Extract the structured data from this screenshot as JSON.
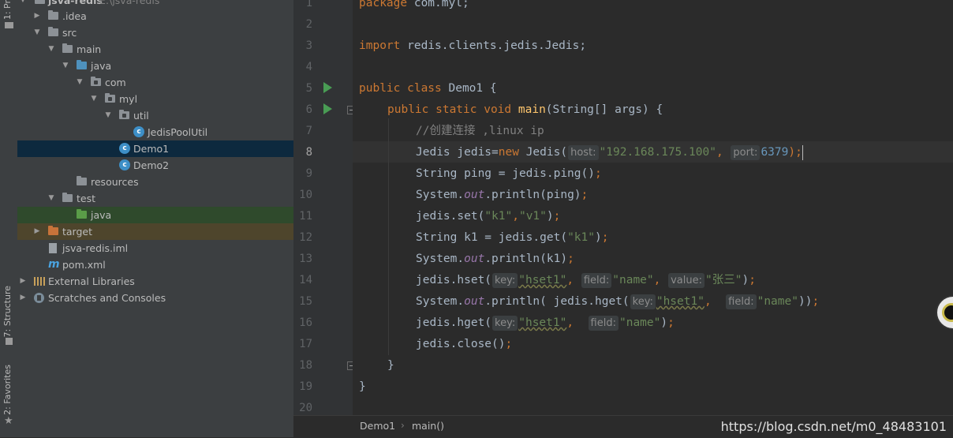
{
  "stripe": {
    "project_tab": "1: Pr",
    "structure_tab": "7: Structure",
    "favorites_tab": "2: Favorites"
  },
  "tree": [
    {
      "label": "jsva-redis",
      "hint": "E:\\jsva-redis"
    },
    {
      "label": ".idea"
    },
    {
      "label": "src"
    },
    {
      "label": "main"
    },
    {
      "label": "java"
    },
    {
      "label": "com"
    },
    {
      "label": "myl"
    },
    {
      "label": "util"
    },
    {
      "label": "JedisPoolUtil"
    },
    {
      "label": "Demo1"
    },
    {
      "label": "Demo2"
    },
    {
      "label": "resources"
    },
    {
      "label": "test"
    },
    {
      "label": "java"
    },
    {
      "label": "target"
    },
    {
      "label": "jsva-redis.iml"
    },
    {
      "label": "pom.xml"
    },
    {
      "label": "External Libraries"
    },
    {
      "label": "Scratches and Consoles"
    }
  ],
  "line_numbers": [
    "1",
    "2",
    "3",
    "4",
    "5",
    "6",
    "7",
    "8",
    "9",
    "10",
    "11",
    "12",
    "13",
    "14",
    "15",
    "16",
    "17",
    "18",
    "19",
    "20"
  ],
  "code": {
    "l1_kw": "package",
    "l1_rest": " com.myl;",
    "l3_kw": "import",
    "l3_rest": " redis.clients.jedis.Jedis;",
    "l5_kw": "public class",
    "l5_rest": " Demo1 {",
    "l6_kw": "public static void",
    "l6_fn": "main",
    "l6_rest": "(String[] args) {",
    "l7_cmt": "//创建连接 ,linux ip",
    "l8_a": "Jedis jedis=",
    "l8_kw": "new",
    "l8_b": " Jedis(",
    "l8_hint1": "host:",
    "l8_str": "\"192.168.175.100\"",
    "l8_c": ",",
    "l8_hint2": "port:",
    "l8_num": "6379",
    "l8_d": ");",
    "l9_a": "String ping = jedis.ping()",
    "l9_b": ";",
    "l10_a": "System.",
    "l10_fld": "out",
    "l10_b": ".println(ping)",
    "l10_c": ";",
    "l11_a": "jedis.set(",
    "l11_s1": "\"k1\"",
    "l11_b": ",",
    "l11_s2": "\"v1\"",
    "l11_c": ")",
    "l11_d": ";",
    "l12_a": "String k1 = jedis.get(",
    "l12_s": "\"k1\"",
    "l12_b": ")",
    "l12_c": ";",
    "l13_a": "System.",
    "l13_fld": "out",
    "l13_b": ".println(k1)",
    "l13_c": ";",
    "l14_a": "jedis.hset(",
    "l14_h1": "key:",
    "l14_s1": "\"hset1\"",
    "l14_b": ",",
    "l14_h2": "field:",
    "l14_s2": "\"name\"",
    "l14_c": ",",
    "l14_h3": "value:",
    "l14_s3": "\"张三\"",
    "l14_d": ")",
    "l14_e": ";",
    "l15_a": "System.",
    "l15_fld": "out",
    "l15_b": ".println( jedis.hget(",
    "l15_h1": "key:",
    "l15_s1": "\"hset1\"",
    "l15_c": ",",
    "l15_h2": "field:",
    "l15_s2": "\"name\"",
    "l15_d": "))",
    "l15_e": ";",
    "l16_a": "jedis.hget(",
    "l16_h1": "key:",
    "l16_s1": "\"hset1\"",
    "l16_b": ",",
    "l16_h2": "field:",
    "l16_s2": "\"name\"",
    "l16_c": ")",
    "l16_d": ";",
    "l17_a": "jedis.close()",
    "l17_b": ";",
    "l18": "}",
    "l19": "}"
  },
  "breadcrumb": {
    "file": "Demo1",
    "method": "main()",
    "separator": "›"
  },
  "watermark": "https://blog.csdn.net/m0_48483101",
  "colors": {
    "keyword": "#cc7832",
    "string": "#6a8759",
    "number": "#6897bb",
    "selection": "#0d293e"
  }
}
